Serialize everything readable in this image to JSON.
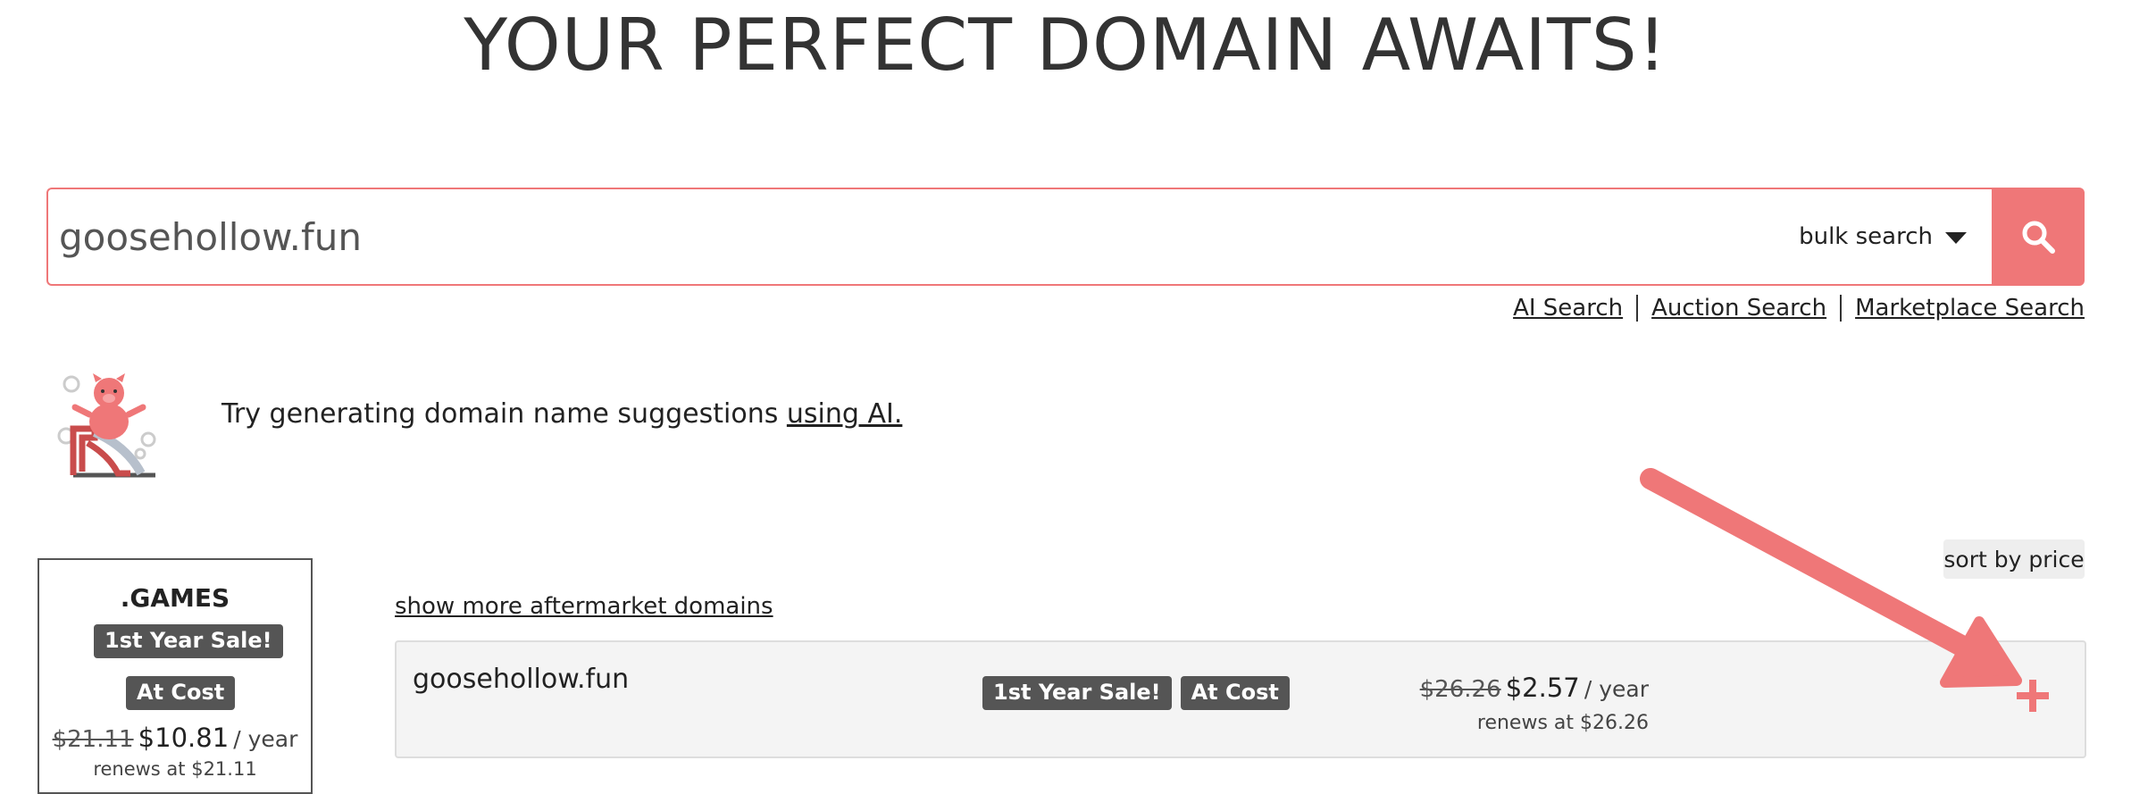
{
  "page": {
    "title": "YOUR PERFECT DOMAIN AWAITS!"
  },
  "search": {
    "value": "goosehollow.fun",
    "bulk_label": "bulk search",
    "button_icon": "search-icon",
    "links": [
      "AI Search",
      "Auction Search",
      "Marketplace Search"
    ]
  },
  "ai_suggestion": {
    "text": "Try generating domain name suggestions ",
    "link": "using AI."
  },
  "sort": {
    "label": "sort by price"
  },
  "featured_tld": {
    "name": ".GAMES",
    "badges": [
      "1st Year Sale!",
      "At Cost"
    ],
    "old_price": "$21.11",
    "price": "$10.81",
    "per": "/ year",
    "renews": "renews at $21.11"
  },
  "results": {
    "show_more": "show more aftermarket domains",
    "items": [
      {
        "domain": "goosehollow.fun",
        "badges": [
          "1st Year Sale!",
          "At Cost"
        ],
        "old_price": "$26.26",
        "price": "$2.57",
        "per": "/ year",
        "renews": "renews at $26.26",
        "action_icon": "plus-icon"
      }
    ]
  },
  "colors": {
    "accent": "#ef7778",
    "badge_bg": "#555555",
    "row_bg": "#f4f4f4",
    "annotation_arrow": "#ef7778"
  }
}
